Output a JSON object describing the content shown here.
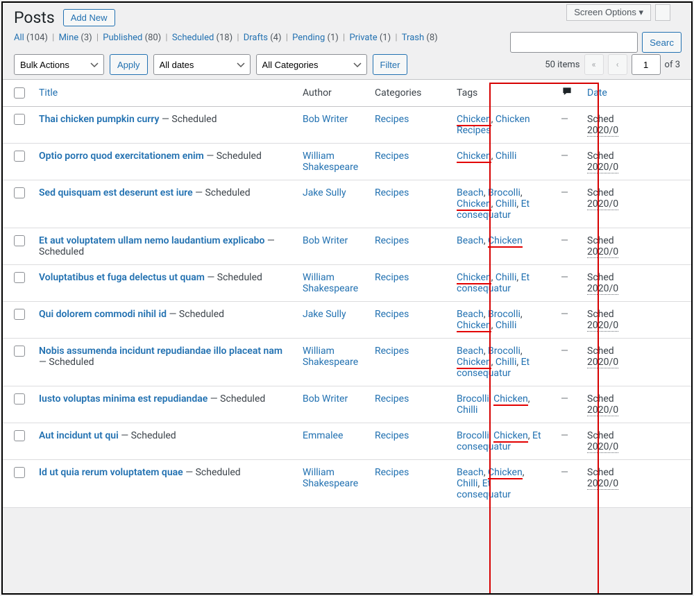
{
  "header": {
    "title": "Posts",
    "add_new": "Add New",
    "screen_options": "Screen Options ▾"
  },
  "filters": [
    {
      "label": "All",
      "count": "104"
    },
    {
      "label": "Mine",
      "count": "3"
    },
    {
      "label": "Published",
      "count": "80"
    },
    {
      "label": "Scheduled",
      "count": "18"
    },
    {
      "label": "Drafts",
      "count": "4"
    },
    {
      "label": "Pending",
      "count": "1"
    },
    {
      "label": "Private",
      "count": "1"
    },
    {
      "label": "Trash",
      "count": "8"
    }
  ],
  "search_btn": "Searc",
  "toolbar": {
    "bulk": "Bulk Actions",
    "apply": "Apply",
    "dates": "All dates",
    "cats": "All Categories",
    "filter": "Filter"
  },
  "pagination": {
    "items": "50 items",
    "current": "1",
    "of": "of 3"
  },
  "columns": {
    "title": "Title",
    "author": "Author",
    "categories": "Categories",
    "tags": "Tags",
    "date": "Date"
  },
  "rows": [
    {
      "title": "Thai chicken pumpkin curry",
      "status": "Scheduled",
      "author": "Bob Writer",
      "cat": "Recipes",
      "tags": [
        {
          "t": "Chicken",
          "u": 1
        },
        {
          "t": ", "
        },
        {
          "t": "Chicken Recipes"
        }
      ],
      "date_status": "Sched",
      "date": "2020/0"
    },
    {
      "title": "Optio porro quod exercitationem enim",
      "status": "Scheduled",
      "author": "William Shakespeare",
      "cat": "Recipes",
      "tags": [
        {
          "t": "Chicken",
          "u": 1
        },
        {
          "t": ", "
        },
        {
          "t": "Chilli"
        }
      ],
      "date_status": "Sched",
      "date": "2020/0"
    },
    {
      "title": "Sed quisquam est deserunt est iure",
      "status": "Scheduled",
      "author": "Jake Sully",
      "cat": "Recipes",
      "tags": [
        {
          "t": "Beach"
        },
        {
          "t": ", "
        },
        {
          "t": "Brocolli"
        },
        {
          "t": ", "
        },
        {
          "t": "Chicken",
          "u": 1
        },
        {
          "t": ", "
        },
        {
          "t": "Chilli"
        },
        {
          "t": ", "
        },
        {
          "t": "Et consequatur"
        }
      ],
      "date_status": "Sched",
      "date": "2020/0"
    },
    {
      "title": "Et aut voluptatem ullam nemo laudantium explicabo",
      "status": "Scheduled",
      "author": "Bob Writer",
      "cat": "Recipes",
      "tags": [
        {
          "t": "Beach"
        },
        {
          "t": ", "
        },
        {
          "t": "Chicken",
          "u": 1
        }
      ],
      "date_status": "Sched",
      "date": "2020/0"
    },
    {
      "title": "Voluptatibus et fuga delectus ut quam",
      "status": "Scheduled",
      "author": "William Shakespeare",
      "cat": "Recipes",
      "tags": [
        {
          "t": "Chicken",
          "u": 1
        },
        {
          "t": ", "
        },
        {
          "t": "Chilli"
        },
        {
          "t": ", "
        },
        {
          "t": "Et consequatur"
        }
      ],
      "date_status": "Sched",
      "date": "2020/0"
    },
    {
      "title": "Qui dolorem commodi nihil id",
      "status": "Scheduled",
      "author": "Jake Sully",
      "cat": "Recipes",
      "tags": [
        {
          "t": "Beach"
        },
        {
          "t": ", "
        },
        {
          "t": "Brocolli"
        },
        {
          "t": ", "
        },
        {
          "t": "Chicken",
          "u": 1
        },
        {
          "t": ", "
        },
        {
          "t": "Chilli"
        }
      ],
      "date_status": "Sched",
      "date": "2020/0"
    },
    {
      "title": "Nobis assumenda incidunt repudiandae illo placeat nam",
      "status": "Scheduled",
      "author": "William Shakespeare",
      "cat": "Recipes",
      "tags": [
        {
          "t": "Beach"
        },
        {
          "t": ", "
        },
        {
          "t": "Brocolli"
        },
        {
          "t": ", "
        },
        {
          "t": "Chicken",
          "u": 1
        },
        {
          "t": ", "
        },
        {
          "t": "Chilli"
        },
        {
          "t": ", "
        },
        {
          "t": "Et consequatur"
        }
      ],
      "date_status": "Sched",
      "date": "2020/0"
    },
    {
      "title": "Iusto voluptas minima est repudiandae",
      "status": "Scheduled",
      "author": "Bob Writer",
      "cat": "Recipes",
      "tags": [
        {
          "t": "Brocolli"
        },
        {
          "t": ", "
        },
        {
          "t": "Chicken",
          "u": 1
        },
        {
          "t": ", "
        },
        {
          "t": "Chilli"
        }
      ],
      "date_status": "Sched",
      "date": "2020/0"
    },
    {
      "title": "Aut incidunt ut qui",
      "status": "Scheduled",
      "author": "Emmalee",
      "cat": "Recipes",
      "tags": [
        {
          "t": "Brocolli"
        },
        {
          "t": ", "
        },
        {
          "t": "Chicken",
          "u": 1
        },
        {
          "t": ", "
        },
        {
          "t": "Et consequatur"
        }
      ],
      "date_status": "Sched",
      "date": "2020/0"
    },
    {
      "title": "Id ut quia rerum voluptatem quae",
      "status": "Scheduled",
      "author": "William Shakespeare",
      "cat": "Recipes",
      "tags": [
        {
          "t": "Beach"
        },
        {
          "t": ", "
        },
        {
          "t": "Chicken",
          "u": 1
        },
        {
          "t": ", "
        },
        {
          "t": "Chilli"
        },
        {
          "t": ", "
        },
        {
          "t": "Et consequatur"
        }
      ],
      "date_status": "Sched",
      "date": "2020/0"
    }
  ]
}
